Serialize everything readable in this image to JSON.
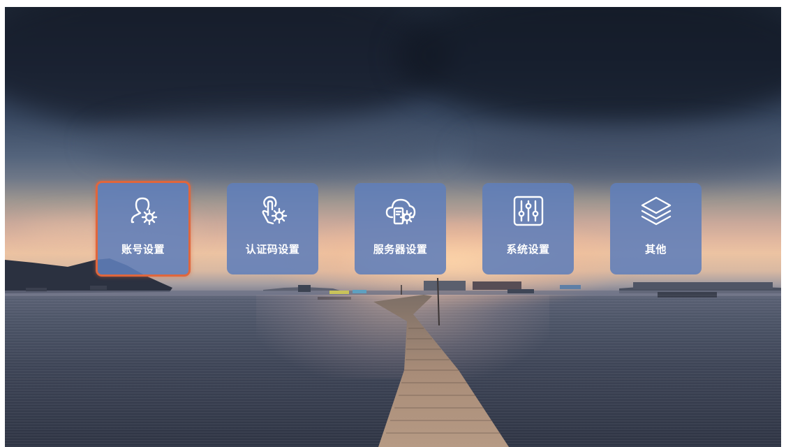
{
  "menu": {
    "items": [
      {
        "label": "账号设置",
        "icon": "user-gear-icon",
        "selected": true
      },
      {
        "label": "认证码设置",
        "icon": "touch-gear-icon",
        "selected": false
      },
      {
        "label": "服务器设置",
        "icon": "cloud-server-gear-icon",
        "selected": false
      },
      {
        "label": "系统设置",
        "icon": "sliders-icon",
        "selected": false
      },
      {
        "label": "其他",
        "icon": "layers-icon",
        "selected": false
      }
    ]
  },
  "colors": {
    "tile_background": "#607EBA",
    "selected_border": "#E0663C",
    "label_text": "#FFFFFF"
  }
}
